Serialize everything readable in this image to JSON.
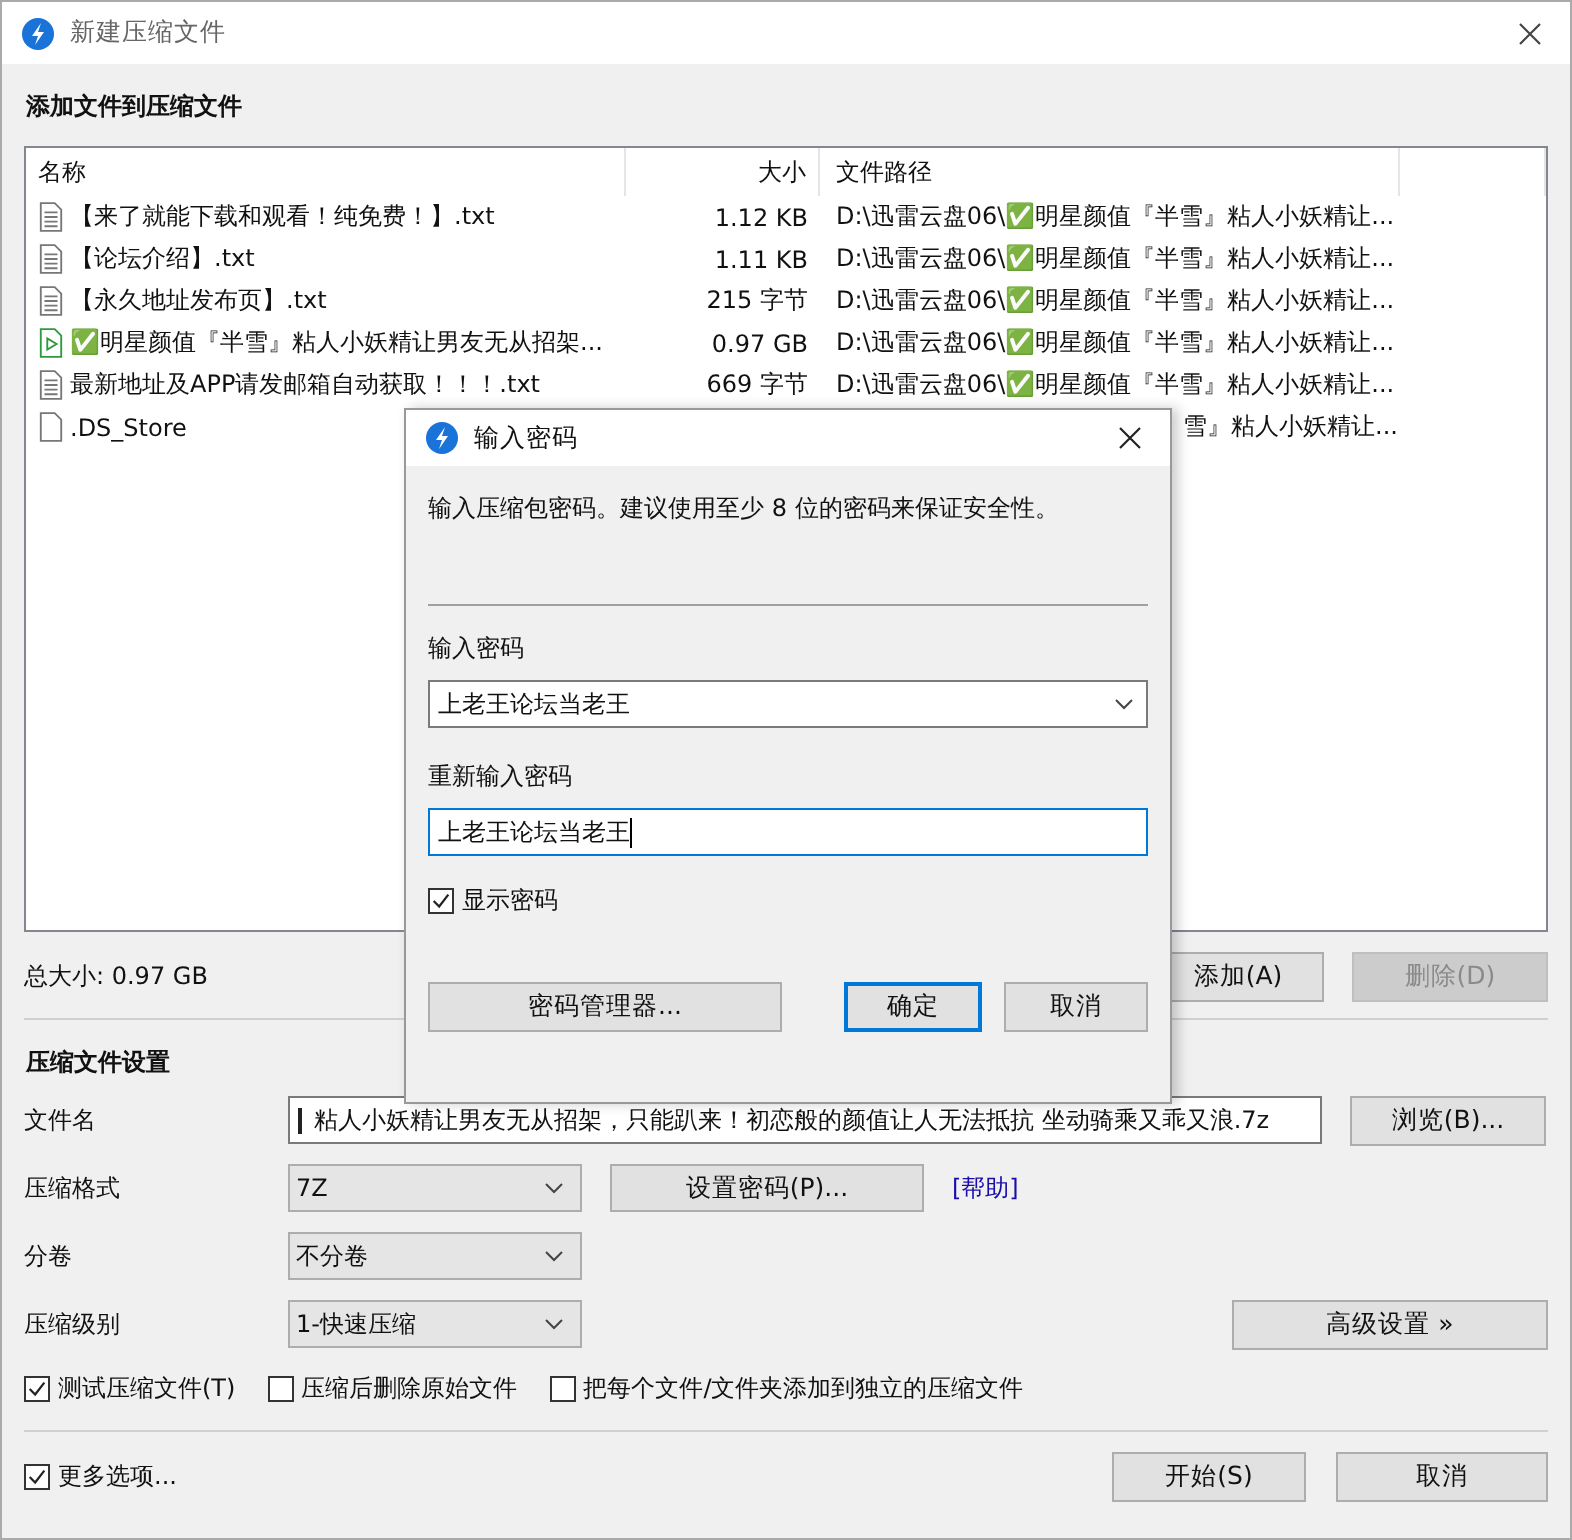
{
  "window": {
    "title": "新建压缩文件"
  },
  "add_section": {
    "heading": "添加文件到压缩文件"
  },
  "file_list": {
    "columns": [
      "名称",
      "大小",
      "文件路径"
    ],
    "rows": [
      {
        "kind": "text",
        "name": "【来了就能下载和观看！纯免费！】.txt",
        "size": "1.12 KB",
        "path": "D:\\迅雷云盘06\\✅明星颜值『半雪』粘人小妖精让..."
      },
      {
        "kind": "text",
        "name": "【论坛介绍】.txt",
        "size": "1.11 KB",
        "path": "D:\\迅雷云盘06\\✅明星颜值『半雪』粘人小妖精让..."
      },
      {
        "kind": "text",
        "name": "【永久地址发布页】.txt",
        "size": "215 字节",
        "path": "D:\\迅雷云盘06\\✅明星颜值『半雪』粘人小妖精让..."
      },
      {
        "kind": "video",
        "name": "✅明星颜值『半雪』粘人小妖精让男友无从招架...",
        "size": "0.97 GB",
        "path": "D:\\迅雷云盘06\\✅明星颜值『半雪』粘人小妖精让..."
      },
      {
        "kind": "text",
        "name": "最新地址及APP请发邮箱自动获取！！！.txt",
        "size": "669 字节",
        "path": "D:\\迅雷云盘06\\✅明星颜值『半雪』粘人小妖精让..."
      },
      {
        "kind": "blank",
        "name": ".DS_Store",
        "path_tail": "雪』粘人小妖精让..."
      }
    ]
  },
  "total_size": "总大小: 0.97 GB",
  "list_buttons": [
    {
      "label": "添加(A)",
      "disabled": false
    },
    {
      "label": "删除(D)",
      "disabled": true
    }
  ],
  "settings": {
    "heading": "压缩文件设置",
    "filename": {
      "label": "文件名",
      "value": "粘人小妖精让男友无从招架，只能趴来！初恋般的颜值让人无法抵抗 坐动骑乘又乖又浪.7z"
    },
    "browse_button": "浏览(B)...",
    "format": {
      "label": "压缩格式",
      "value": "7Z"
    },
    "set_password_button": "设置密码(P)...",
    "help_link": "[帮助]",
    "volume": {
      "label": "分卷",
      "value": "不分卷"
    },
    "level": {
      "label": "压缩级别",
      "value": "1-快速压缩"
    },
    "advanced_button": "高级设置 »",
    "options": [
      {
        "label": "测试压缩文件(T)",
        "checked": true
      },
      {
        "label": "压缩后删除原始文件",
        "checked": false
      },
      {
        "label": "把每个文件/文件夹添加到独立的压缩文件",
        "checked": false
      }
    ]
  },
  "footer": {
    "more_options": {
      "label": "更多选项...",
      "checked": true
    },
    "start_button": "开始(S)",
    "cancel_button": "取消"
  },
  "dialog": {
    "title": "输入密码",
    "description": "输入压缩包密码。建议使用至少 8 位的密码来保证安全性。",
    "password": {
      "label": "输入密码",
      "value": "上老王论坛当老王"
    },
    "confirm": {
      "label": "重新输入密码",
      "value": "上老王论坛当老王"
    },
    "show_password": {
      "label": "显示密码",
      "checked": true
    },
    "manager_button": "密码管理器...",
    "ok_button": "确定",
    "cancel_button": "取消"
  }
}
